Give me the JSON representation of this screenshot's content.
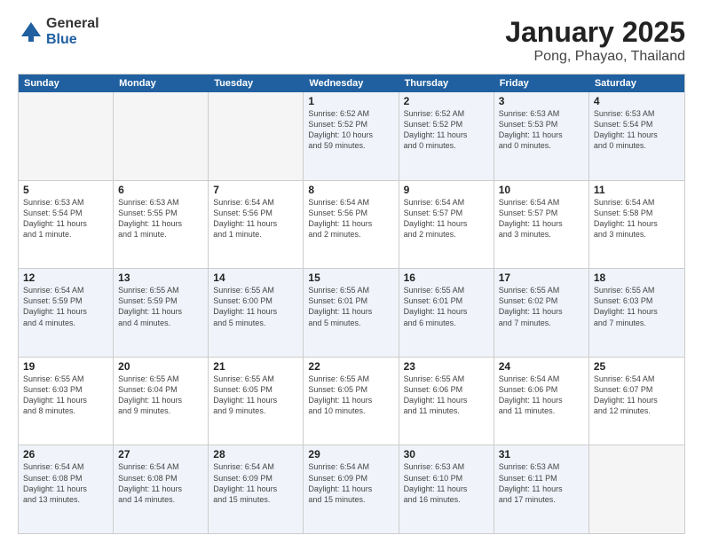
{
  "logo": {
    "general": "General",
    "blue": "Blue"
  },
  "title": "January 2025",
  "subtitle": "Pong, Phayao, Thailand",
  "days": [
    "Sunday",
    "Monday",
    "Tuesday",
    "Wednesday",
    "Thursday",
    "Friday",
    "Saturday"
  ],
  "weeks": [
    [
      {
        "day": "",
        "info": ""
      },
      {
        "day": "",
        "info": ""
      },
      {
        "day": "",
        "info": ""
      },
      {
        "day": "1",
        "info": "Sunrise: 6:52 AM\nSunset: 5:52 PM\nDaylight: 10 hours\nand 59 minutes."
      },
      {
        "day": "2",
        "info": "Sunrise: 6:52 AM\nSunset: 5:52 PM\nDaylight: 11 hours\nand 0 minutes."
      },
      {
        "day": "3",
        "info": "Sunrise: 6:53 AM\nSunset: 5:53 PM\nDaylight: 11 hours\nand 0 minutes."
      },
      {
        "day": "4",
        "info": "Sunrise: 6:53 AM\nSunset: 5:54 PM\nDaylight: 11 hours\nand 0 minutes."
      }
    ],
    [
      {
        "day": "5",
        "info": "Sunrise: 6:53 AM\nSunset: 5:54 PM\nDaylight: 11 hours\nand 1 minute."
      },
      {
        "day": "6",
        "info": "Sunrise: 6:53 AM\nSunset: 5:55 PM\nDaylight: 11 hours\nand 1 minute."
      },
      {
        "day": "7",
        "info": "Sunrise: 6:54 AM\nSunset: 5:56 PM\nDaylight: 11 hours\nand 1 minute."
      },
      {
        "day": "8",
        "info": "Sunrise: 6:54 AM\nSunset: 5:56 PM\nDaylight: 11 hours\nand 2 minutes."
      },
      {
        "day": "9",
        "info": "Sunrise: 6:54 AM\nSunset: 5:57 PM\nDaylight: 11 hours\nand 2 minutes."
      },
      {
        "day": "10",
        "info": "Sunrise: 6:54 AM\nSunset: 5:57 PM\nDaylight: 11 hours\nand 3 minutes."
      },
      {
        "day": "11",
        "info": "Sunrise: 6:54 AM\nSunset: 5:58 PM\nDaylight: 11 hours\nand 3 minutes."
      }
    ],
    [
      {
        "day": "12",
        "info": "Sunrise: 6:54 AM\nSunset: 5:59 PM\nDaylight: 11 hours\nand 4 minutes."
      },
      {
        "day": "13",
        "info": "Sunrise: 6:55 AM\nSunset: 5:59 PM\nDaylight: 11 hours\nand 4 minutes."
      },
      {
        "day": "14",
        "info": "Sunrise: 6:55 AM\nSunset: 6:00 PM\nDaylight: 11 hours\nand 5 minutes."
      },
      {
        "day": "15",
        "info": "Sunrise: 6:55 AM\nSunset: 6:01 PM\nDaylight: 11 hours\nand 5 minutes."
      },
      {
        "day": "16",
        "info": "Sunrise: 6:55 AM\nSunset: 6:01 PM\nDaylight: 11 hours\nand 6 minutes."
      },
      {
        "day": "17",
        "info": "Sunrise: 6:55 AM\nSunset: 6:02 PM\nDaylight: 11 hours\nand 7 minutes."
      },
      {
        "day": "18",
        "info": "Sunrise: 6:55 AM\nSunset: 6:03 PM\nDaylight: 11 hours\nand 7 minutes."
      }
    ],
    [
      {
        "day": "19",
        "info": "Sunrise: 6:55 AM\nSunset: 6:03 PM\nDaylight: 11 hours\nand 8 minutes."
      },
      {
        "day": "20",
        "info": "Sunrise: 6:55 AM\nSunset: 6:04 PM\nDaylight: 11 hours\nand 9 minutes."
      },
      {
        "day": "21",
        "info": "Sunrise: 6:55 AM\nSunset: 6:05 PM\nDaylight: 11 hours\nand 9 minutes."
      },
      {
        "day": "22",
        "info": "Sunrise: 6:55 AM\nSunset: 6:05 PM\nDaylight: 11 hours\nand 10 minutes."
      },
      {
        "day": "23",
        "info": "Sunrise: 6:55 AM\nSunset: 6:06 PM\nDaylight: 11 hours\nand 11 minutes."
      },
      {
        "day": "24",
        "info": "Sunrise: 6:54 AM\nSunset: 6:06 PM\nDaylight: 11 hours\nand 11 minutes."
      },
      {
        "day": "25",
        "info": "Sunrise: 6:54 AM\nSunset: 6:07 PM\nDaylight: 11 hours\nand 12 minutes."
      }
    ],
    [
      {
        "day": "26",
        "info": "Sunrise: 6:54 AM\nSunset: 6:08 PM\nDaylight: 11 hours\nand 13 minutes."
      },
      {
        "day": "27",
        "info": "Sunrise: 6:54 AM\nSunset: 6:08 PM\nDaylight: 11 hours\nand 14 minutes."
      },
      {
        "day": "28",
        "info": "Sunrise: 6:54 AM\nSunset: 6:09 PM\nDaylight: 11 hours\nand 15 minutes."
      },
      {
        "day": "29",
        "info": "Sunrise: 6:54 AM\nSunset: 6:09 PM\nDaylight: 11 hours\nand 15 minutes."
      },
      {
        "day": "30",
        "info": "Sunrise: 6:53 AM\nSunset: 6:10 PM\nDaylight: 11 hours\nand 16 minutes."
      },
      {
        "day": "31",
        "info": "Sunrise: 6:53 AM\nSunset: 6:11 PM\nDaylight: 11 hours\nand 17 minutes."
      },
      {
        "day": "",
        "info": ""
      }
    ]
  ],
  "altWeeks": [
    0,
    2,
    4
  ]
}
